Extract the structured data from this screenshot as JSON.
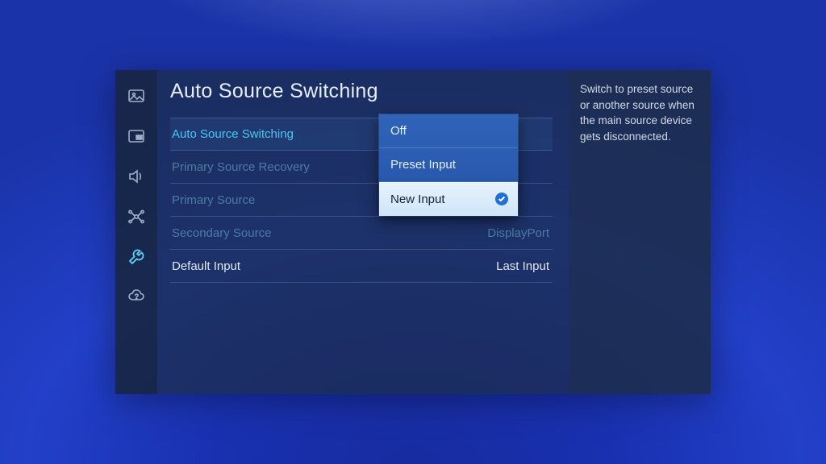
{
  "title": "Auto Source Switching",
  "help": "Switch to preset source or another source when the main source device gets disconnected.",
  "rows": [
    {
      "label": "Auto Source Switching",
      "value": ""
    },
    {
      "label": "Primary Source Recovery",
      "value": ""
    },
    {
      "label": "Primary Source",
      "value": ""
    },
    {
      "label": "Secondary Source",
      "value": "DisplayPort"
    },
    {
      "label": "Default Input",
      "value": "Last Input"
    }
  ],
  "dropdown": {
    "items": [
      {
        "label": "Off"
      },
      {
        "label": "Preset Input"
      },
      {
        "label": "New Input"
      }
    ]
  },
  "sidebar_icons": [
    "picture-icon",
    "pip-icon",
    "sound-icon",
    "network-icon",
    "system-icon",
    "support-icon"
  ]
}
